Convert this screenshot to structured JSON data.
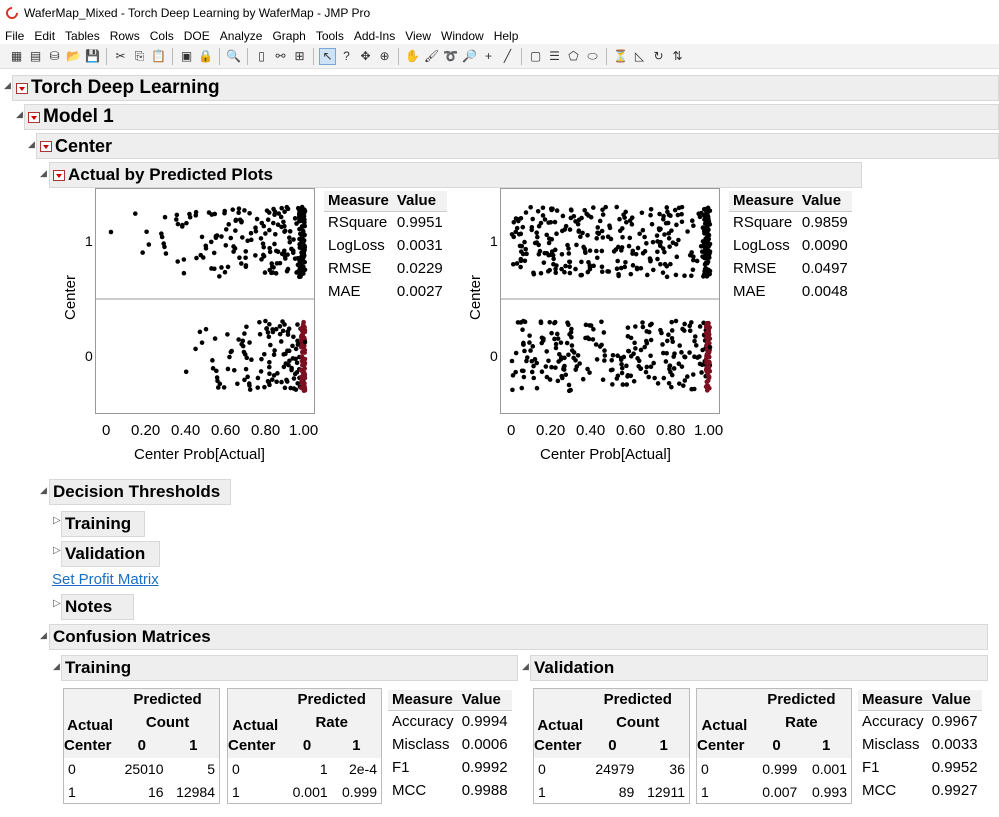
{
  "window": {
    "title": "WaferMap_Mixed - Torch Deep Learning by WaferMap - JMP Pro"
  },
  "menu": [
    "File",
    "Edit",
    "Tables",
    "Rows",
    "Cols",
    "DOE",
    "Analyze",
    "Graph",
    "Tools",
    "Add-Ins",
    "View",
    "Window",
    "Help"
  ],
  "outline": {
    "root": "Torch Deep Learning",
    "model": "Model 1",
    "center": "Center",
    "plots": "Actual by Predicted Plots",
    "thresholds": "Decision Thresholds",
    "training": "Training",
    "validation": "Validation",
    "profit_link": "Set Profit Matrix",
    "notes": "Notes",
    "confusion": "Confusion Matrices",
    "cm_training": "Training",
    "cm_validation": "Validation"
  },
  "chart_data": [
    {
      "type": "scatter",
      "panel": "training",
      "ylabel": "Center",
      "xlabel": "Center Prob[Actual]",
      "x_ticks": [
        "0",
        "0.20",
        "0.40",
        "0.60",
        "0.80",
        "1.00"
      ],
      "y_ticks": [
        "1",
        "0"
      ],
      "xlim": [
        0,
        1
      ],
      "series": [
        {
          "values_actual_1": [
            0.02,
            0.18,
            0.2,
            0.35,
            0.38,
            0.42,
            0.45,
            0.48,
            0.5,
            0.55,
            0.6,
            0.65,
            0.7,
            0.72,
            0.75,
            0.8,
            0.85,
            0.9,
            0.95,
            1.0
          ]
        },
        {
          "values_actual_0": [
            0.4,
            0.48,
            0.5,
            0.57,
            0.63,
            0.68,
            0.72,
            0.78,
            0.82,
            0.88,
            0.92,
            0.96,
            1.0
          ]
        }
      ]
    },
    {
      "type": "scatter",
      "panel": "validation",
      "ylabel": "Center",
      "xlabel": "Center Prob[Actual]",
      "x_ticks": [
        "0",
        "0.20",
        "0.40",
        "0.60",
        "0.80",
        "1.00"
      ],
      "y_ticks": [
        "1",
        "0"
      ],
      "xlim": [
        0,
        1
      ],
      "series": [
        {
          "values_actual_1": [
            0.0,
            0.1,
            0.2,
            0.3,
            0.4,
            0.5,
            0.6,
            0.7,
            0.8,
            0.9,
            1.0
          ]
        },
        {
          "values_actual_0": [
            0.0,
            0.1,
            0.2,
            0.3,
            0.4,
            0.5,
            0.6,
            0.7,
            0.8,
            0.9,
            1.0
          ]
        }
      ]
    }
  ],
  "measures": {
    "header": [
      "Measure",
      "Value"
    ],
    "training": [
      [
        "RSquare",
        "0.9951"
      ],
      [
        "LogLoss",
        "0.0031"
      ],
      [
        "RMSE",
        "0.0229"
      ],
      [
        "MAE",
        "0.0027"
      ]
    ],
    "validation": [
      [
        "RSquare",
        "0.9859"
      ],
      [
        "LogLoss",
        "0.0090"
      ],
      [
        "RMSE",
        "0.0497"
      ],
      [
        "MAE",
        "0.0048"
      ]
    ]
  },
  "cm": {
    "actual": "Actual",
    "predicted": "Predicted",
    "count": "Count",
    "rate": "Rate",
    "center": "Center",
    "c0": "0",
    "c1": "1",
    "train_count": [
      [
        "0",
        "25010",
        "5"
      ],
      [
        "1",
        "16",
        "12984"
      ]
    ],
    "train_rate": [
      [
        "0",
        "1",
        "2e-4"
      ],
      [
        "1",
        "0.001",
        "0.999"
      ]
    ],
    "train_meas": [
      [
        "Accuracy",
        "0.9994"
      ],
      [
        "Misclass",
        "0.0006"
      ],
      [
        "F1",
        "0.9992"
      ],
      [
        "MCC",
        "0.9988"
      ]
    ],
    "val_count": [
      [
        "0",
        "24979",
        "36"
      ],
      [
        "1",
        "89",
        "12911"
      ]
    ],
    "val_rate": [
      [
        "0",
        "0.999",
        "0.001"
      ],
      [
        "1",
        "0.007",
        "0.993"
      ]
    ],
    "val_meas": [
      [
        "Accuracy",
        "0.9967"
      ],
      [
        "Misclass",
        "0.0033"
      ],
      [
        "F1",
        "0.9952"
      ],
      [
        "MCC",
        "0.9927"
      ]
    ]
  }
}
